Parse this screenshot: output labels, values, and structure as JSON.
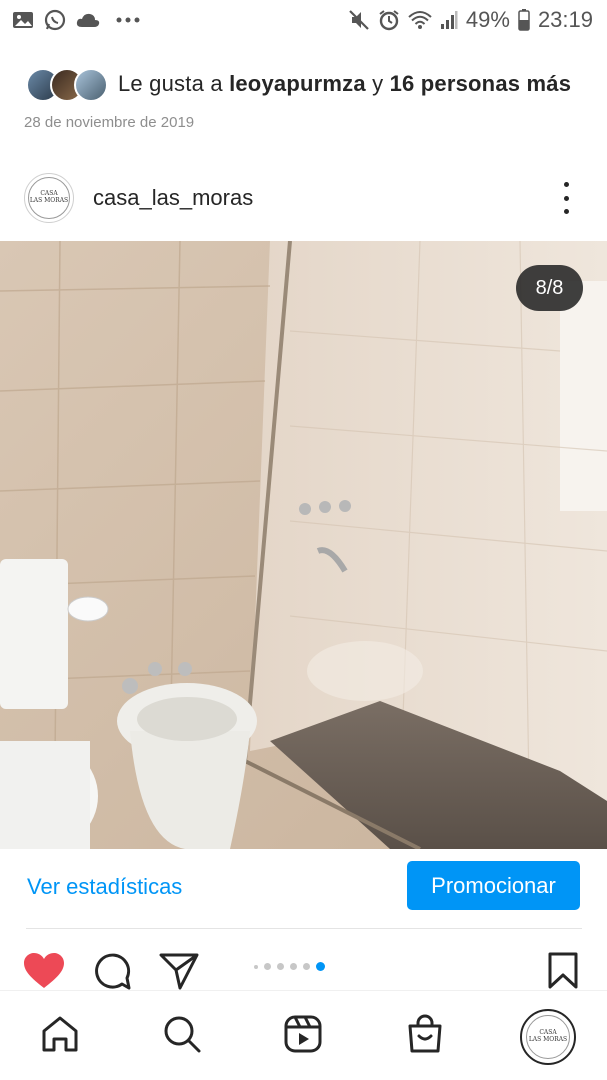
{
  "status_bar": {
    "battery": "49%",
    "time": "23:19",
    "left_icons": [
      "image-icon",
      "whatsapp-icon",
      "cloud-icon",
      "more-dots-icon"
    ],
    "right_icons": [
      "mute-icon",
      "alarm-icon",
      "wifi-icon",
      "signal-icon",
      "battery-icon"
    ]
  },
  "likes": {
    "prefix": "Le gusta a",
    "user": "leoyapurmza",
    "connector": "y",
    "others": "16 personas más"
  },
  "post": {
    "date": "28 de noviembre de 2019",
    "username": "casa_las_moras",
    "avatar_text_line1": "CASA",
    "avatar_text_line2": "LAS MORAS",
    "image_counter": "8/8",
    "carousel_total": 8,
    "carousel_index": 8
  },
  "actions": {
    "stats_label": "Ver estadísticas",
    "promote_label": "Promocionar"
  },
  "colors": {
    "accent": "#0095f6",
    "like": "#ed4956",
    "text": "#262626",
    "muted": "#8e8e8e"
  },
  "nav": [
    "home-icon",
    "search-icon",
    "reels-icon",
    "shop-icon",
    "profile-avatar"
  ]
}
